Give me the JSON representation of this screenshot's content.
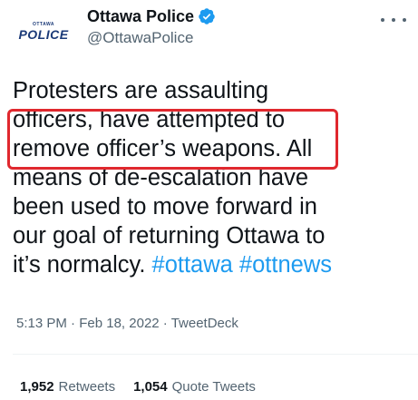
{
  "account": {
    "avatar_small_text": "OTTAWA",
    "avatar_big_text": "POLICE",
    "display_name": "Ottawa Police",
    "handle": "@OttawaPolice"
  },
  "tweet": {
    "lines": [
      "Protesters are assaulting",
      "officers, have attempted to",
      "remove officer’s weapons. All",
      "means of de-escalation have",
      "been used to move forward in",
      "our goal of returning Ottawa to"
    ],
    "last_line_text": "it’s normalcy. ",
    "hashtags": [
      "#ottawa",
      "#ottnews"
    ]
  },
  "meta": {
    "time": "5:13 PM",
    "separator": " · ",
    "date": "Feb 18, 2022",
    "source": "TweetDeck"
  },
  "stats": {
    "retweets_count": "1,952",
    "retweets_label": "Retweets",
    "quote_count": "1,054",
    "quote_label": "Quote Tweets"
  },
  "colors": {
    "text": "#0f1419",
    "secondary": "#536471",
    "link": "#1d9bf0",
    "highlight": "#e0282e",
    "police_blue": "#1b3a78"
  }
}
